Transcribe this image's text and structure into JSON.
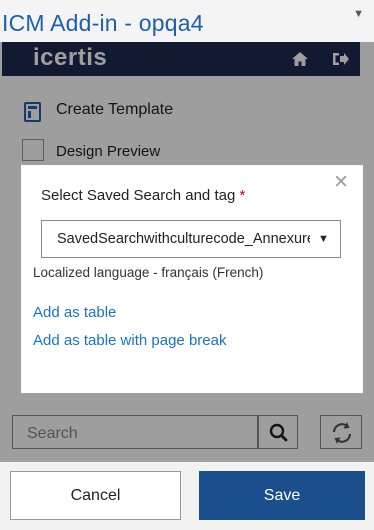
{
  "window": {
    "title": "ICM Add-in - opqa4",
    "caret_icon": "chevron-down-icon",
    "pin_icon": "pin-icon"
  },
  "appbar": {
    "logo": "icertis",
    "home_icon": "home-icon",
    "signout_icon": "sign-out-icon",
    "bg_color": "#1e2a52"
  },
  "menu": {
    "create_template": "Create Template",
    "design_preview": "Design Preview"
  },
  "dialog": {
    "label": "Select Saved Search and tag",
    "required_mark": "*",
    "selected_value": "SavedSearchwithculturecode_Annexure",
    "localized_text": "Localized language - français (French)",
    "link_add_table": "Add as table",
    "link_add_table_break": "Add as table with page break",
    "close_icon": "close-icon"
  },
  "search": {
    "placeholder": "Search",
    "search_icon": "search-icon",
    "refresh_icon": "refresh-icon"
  },
  "footer": {
    "cancel_label": "Cancel",
    "save_label": "Save",
    "save_color": "#1b4e8c"
  }
}
